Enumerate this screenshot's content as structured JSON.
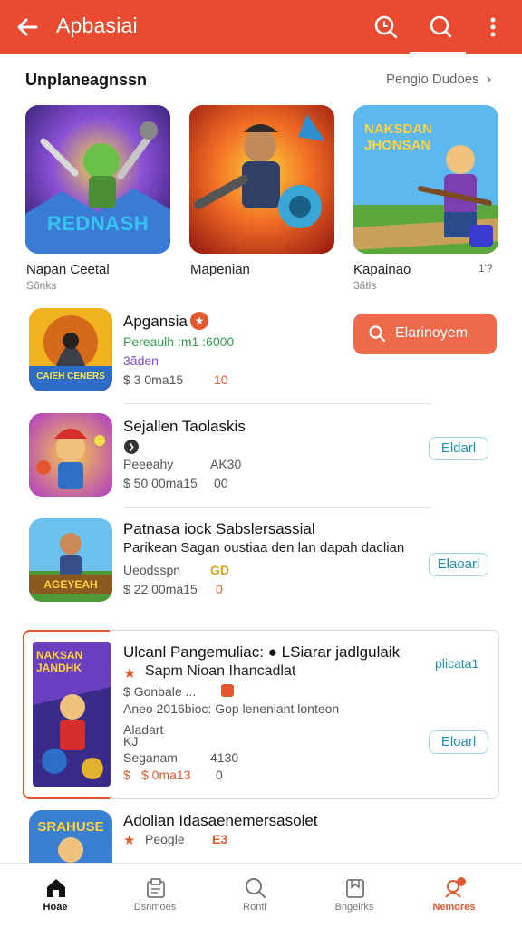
{
  "app_bar": {
    "title": "Apbasiai",
    "back_icon": "arrow-left-icon",
    "icons": [
      "search-zoom-icon",
      "search-icon",
      "more-vert-icon"
    ]
  },
  "section": {
    "title": "Unplaneagnssn",
    "link": "Pengio Dudoes"
  },
  "cards": [
    {
      "art_text": "REDNASH",
      "name": "Napan Ceetal",
      "sub": "Sõnks"
    },
    {
      "art_text": "",
      "name": "Mapenian",
      "sub": ""
    },
    {
      "art_text": "NAKSDAN JHONSAN",
      "name": "Kapainao",
      "sub": "3ãtls",
      "extra": "1'?"
    }
  ],
  "rows": [
    {
      "title": "Apgansia",
      "line1": "Pereaulh :m1 :6000",
      "line2": "3ãden",
      "meta": "$ 3 0ma15",
      "meta_value": "10",
      "icon_text": "CAIEH CENERS",
      "button": "Elarinoyem"
    },
    {
      "title": "Sejallen Taolaskis",
      "line1": "Peeeahy",
      "line1_value": "AK30",
      "meta": "$ 50 00ma15",
      "meta_value": "00",
      "button": "Eldarl"
    },
    {
      "title": "Patnasa iock Sabslersassial",
      "line1": "Parikean Sagan oustiaa den lan dapah daclian",
      "line2": "Ueodsspn",
      "line2_value": "GD",
      "meta": "$ 22 00ma15",
      "meta_value": "0",
      "icon_text": "AGEYEAH",
      "button": "Elaoarl"
    },
    {
      "title": "Ulcanl Pangemuliac: ● LSiarar jadlgulaik",
      "line1": "Sapm Nioan Ihancadlat",
      "line2": "$ Gonbale ...",
      "line3": "Aneo 2016bioc: Gop lenenlant lonteon",
      "line4": "Aladart",
      "line5": "KJ",
      "line6": "Seganam",
      "line6_value": "4130",
      "meta": "$ 0ma13",
      "meta_value": "0",
      "icon_text": "NAKSAN JANDHK",
      "side_label": "plicata1",
      "button": "Eloarl"
    },
    {
      "title": "Adolian Idasaenemersasolet",
      "line1": "Peogle",
      "line1_value": "E3",
      "icon_text": "SRAHUSE"
    }
  ],
  "bottom_nav": [
    {
      "label": "Hoae",
      "icon": "home-icon"
    },
    {
      "label": "Dsnmoes",
      "icon": "grid-doc-icon"
    },
    {
      "label": "Ronti",
      "icon": "search-icon"
    },
    {
      "label": "Bngeirks",
      "icon": "library-icon"
    },
    {
      "label": "Nemores",
      "icon": "notification-icon"
    }
  ],
  "colors": {
    "brand": "#ea4a2f",
    "button": "#ef6a4b",
    "accent": "#e2572e",
    "link": "#1d8fb0"
  }
}
